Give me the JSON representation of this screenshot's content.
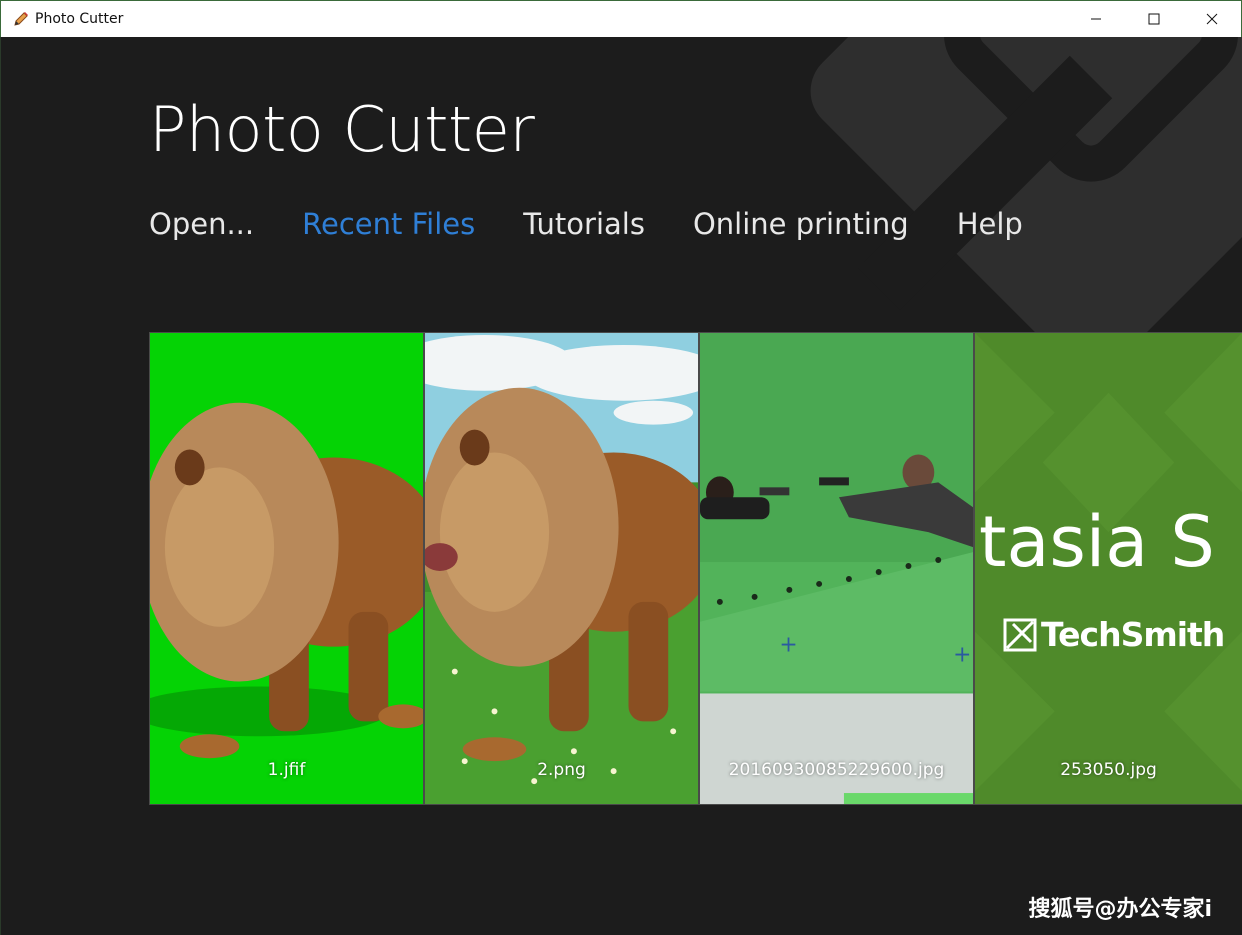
{
  "window": {
    "title": "Photo Cutter",
    "controls": {
      "minimize": "minimize",
      "maximize": "maximize",
      "close": "close"
    }
  },
  "app": {
    "heading": "Photo Cutter",
    "accent_color": "#2f7fd6",
    "nav": [
      {
        "label": "Open...",
        "active": false
      },
      {
        "label": "Recent Files",
        "active": true
      },
      {
        "label": "Tutorials",
        "active": false
      },
      {
        "label": "Online printing",
        "active": false
      },
      {
        "label": "Help",
        "active": false
      }
    ]
  },
  "recent_files": [
    {
      "name": "1.jfif",
      "thumbnail": "lion-on-green-screen"
    },
    {
      "name": "2.png",
      "thumbnail": "lion-on-grass-field"
    },
    {
      "name": "20160930085229600.jpg",
      "thumbnail": "green-screen-gunfight-scene"
    },
    {
      "name": "253050.jpg",
      "thumbnail": "techsmith-camtasia-splash"
    }
  ],
  "thumbnail_text": {
    "splash_title": "tasia S",
    "splash_brand": "TechSmith"
  },
  "watermark": "搜狐号@办公专家i"
}
